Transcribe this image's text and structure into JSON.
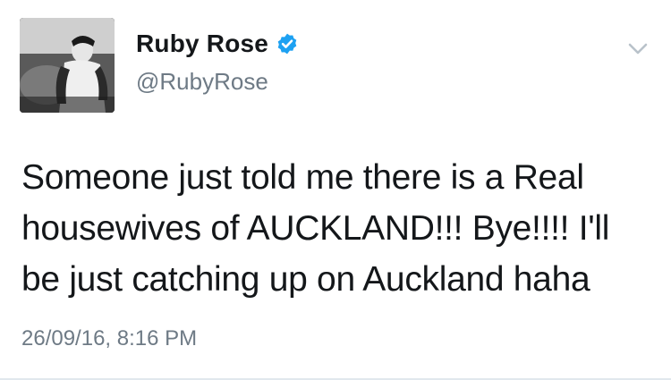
{
  "tweet": {
    "author": {
      "display_name": "Ruby Rose",
      "handle": "@RubyRose",
      "verified": true,
      "avatar_icon": "profile-photo"
    },
    "text": "Someone just told me there is a Real\nhousewives of AUCKLAND!!! Bye!!!! I'll\nbe just catching up on Auckland haha",
    "timestamp": "26/09/16, 8:16 PM",
    "menu_icon": "chevron-down-icon"
  },
  "colors": {
    "verified_badge": "#1da1f2",
    "secondary_text": "#6e7a85",
    "primary_text": "#14171a",
    "chevron": "#b9c2ca"
  }
}
